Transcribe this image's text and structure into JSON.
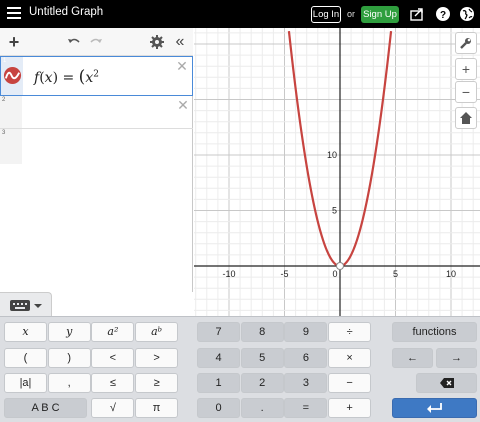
{
  "app": {
    "title": "Untitled Graph",
    "login": "Log In",
    "or": "or",
    "signup": "Sign Up"
  },
  "expressions": [
    {
      "index": "1",
      "latex": "f(x) = (x²",
      "tex_lhs": "f",
      "tex_var": "x",
      "tex_eq": "=",
      "tex_base": "x",
      "tex_exp": "2"
    },
    {
      "index": "2",
      "latex": ""
    },
    {
      "index": "3",
      "latex": ""
    }
  ],
  "graph": {
    "x_ticks": [
      "-10",
      "-5",
      "0",
      "5",
      "10"
    ],
    "y_ticks": [
      "5",
      "10"
    ],
    "curve_color": "#c74440"
  },
  "side_buttons": [
    "+",
    "−"
  ],
  "keypad": {
    "left": [
      [
        "x",
        "y",
        "a²",
        "aᵇ"
      ],
      [
        "(",
        ")",
        "<",
        ">"
      ],
      [
        "|a|",
        ",",
        "≤",
        "≥"
      ],
      [
        "A B C",
        "√",
        "π"
      ]
    ],
    "mid": [
      [
        "7",
        "8",
        "9",
        "÷"
      ],
      [
        "4",
        "5",
        "6",
        "×"
      ],
      [
        "1",
        "2",
        "3",
        "−"
      ],
      [
        "0",
        ".",
        "=",
        "+"
      ]
    ],
    "right": {
      "functions": "functions",
      "left_arrow": "←",
      "right_arrow": "→"
    }
  }
}
